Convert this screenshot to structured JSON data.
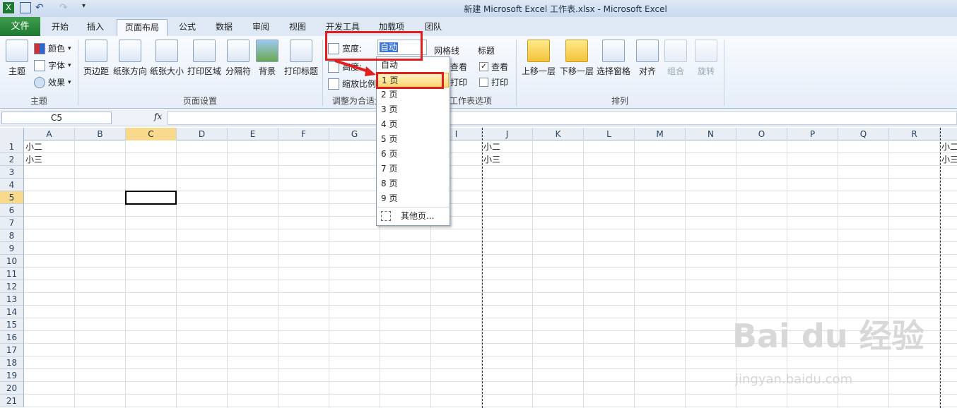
{
  "window": {
    "title": "新建 Microsoft Excel 工作表.xlsx  -  Microsoft Excel"
  },
  "tabs": [
    "文件",
    "开始",
    "插入",
    "页面布局",
    "公式",
    "数据",
    "审阅",
    "视图",
    "开发工具",
    "加载项",
    "团队"
  ],
  "ribbon": {
    "theme": {
      "big": "主题",
      "colors": "颜色",
      "fonts": "字体",
      "effects": "效果",
      "group": "主题"
    },
    "page_setup": {
      "margins": "页边距",
      "orientation": "纸张方向",
      "size": "纸张大小",
      "print_area": "打印区域",
      "breaks": "分隔符",
      "background": "背景",
      "print_titles": "打印标题",
      "group": "页面设置"
    },
    "scale": {
      "width_label": "宽度:",
      "width_value": "自动",
      "height_label": "高度:",
      "scale_label": "缩放比例",
      "group": "调整为合适大小"
    },
    "sheet_options": {
      "gridlines": "网格线",
      "headings": "标题",
      "view": "查看",
      "print": "打印",
      "view2": "查看",
      "print2": "打印",
      "group": "工作表选项"
    },
    "arrange": {
      "forward": "上移一层",
      "backward": "下移一层",
      "pane": "选择窗格",
      "align": "对齐",
      "group_btn": "组合",
      "rotate": "旋转",
      "group": "排列"
    }
  },
  "formula_bar": {
    "name_box": "C5",
    "fx": "fx",
    "value": ""
  },
  "columns": [
    "A",
    "B",
    "C",
    "D",
    "E",
    "F",
    "G",
    "H",
    "I",
    "J",
    "K",
    "L",
    "M",
    "N",
    "O",
    "P",
    "Q",
    "R"
  ],
  "rows": [
    "1",
    "2",
    "3",
    "4",
    "5",
    "6",
    "7",
    "8",
    "9",
    "10",
    "11",
    "12",
    "13",
    "14",
    "15",
    "16",
    "17",
    "18",
    "19",
    "20",
    "21"
  ],
  "cells": {
    "A1": "小二",
    "A2": "小三",
    "J1": "小二",
    "J2": "小三",
    "S1": "小二",
    "S2": "小三"
  },
  "dropdown": {
    "items": [
      "自动",
      "1 页",
      "2 页",
      "3 页",
      "4 页",
      "5 页",
      "6 页",
      "7 页",
      "8 页",
      "9 页"
    ],
    "highlighted": "1 页",
    "more": "其他页..."
  },
  "watermark": {
    "brand": "Bai du 经验",
    "url": "jingyan.baidu.com"
  }
}
